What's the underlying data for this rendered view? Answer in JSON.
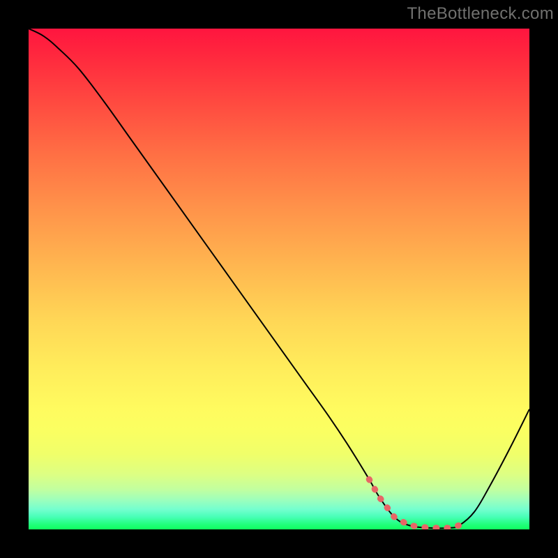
{
  "watermark": "TheBottleneck.com",
  "colors": {
    "frame": "#000000",
    "line": "#000000",
    "flat_marker": "#e76666"
  },
  "chart_data": {
    "type": "line",
    "title": "",
    "xlabel": "",
    "ylabel": "",
    "xlim": [
      0,
      100
    ],
    "ylim": [
      0,
      100
    ],
    "x": [
      0,
      3,
      6,
      10,
      15,
      20,
      25,
      30,
      35,
      40,
      45,
      50,
      55,
      60,
      64,
      68,
      70,
      73,
      76,
      80,
      84,
      86,
      89,
      92,
      96,
      100
    ],
    "y": [
      100,
      98.5,
      96,
      92,
      85.5,
      78.5,
      71.5,
      64.5,
      57.5,
      50.5,
      43.5,
      36.5,
      29.5,
      22.5,
      16.5,
      10,
      6.5,
      2.5,
      0.8,
      0.3,
      0.3,
      0.8,
      3.5,
      8.5,
      16,
      24
    ],
    "flat_region_x": [
      67,
      87
    ],
    "note": "Values are unlabeled; inferred on a 0–100 normalized scale. Curve descends from top-left, reaches a flat minimum near x≈67–87 (highlighted with salmon dotted markers), then rises toward bottom-right."
  }
}
